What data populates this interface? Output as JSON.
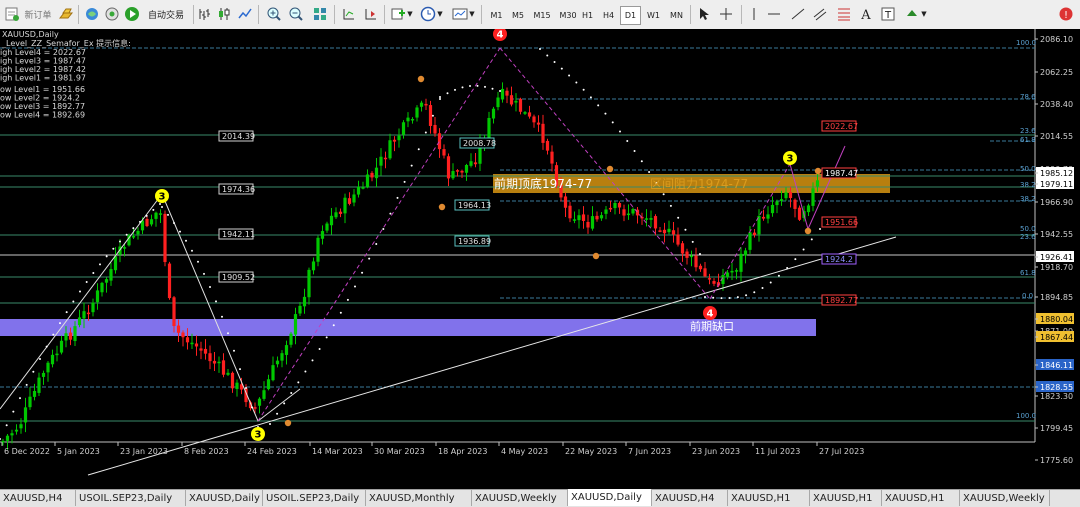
{
  "toolbar": {
    "new_order_label": "新订单",
    "auto_trade_label": "自动交易",
    "timeframes": [
      "M1",
      "M5",
      "M15",
      "M30",
      "H1",
      "H4",
      "D1",
      "W1",
      "MN"
    ],
    "active_timeframe": "D1"
  },
  "chart": {
    "symbol_line": "XAUUSD,Daily",
    "indicator_line": "_Level_ZZ_Semafor_Ex 提示信息:",
    "high_levels": [
      "igh Level4 = 2022.67",
      "igh Level3 = 1987.47",
      "igh Level2 = 1987.42",
      "igh Level1 = 1981.97"
    ],
    "low_levels": [
      "ow Level1 = 1951.66",
      "ow Level2 = 1924.2",
      "ow Level3 = 1892.77",
      "ow Level4 = 1892.69"
    ],
    "price_axis": [
      {
        "text": "2086.10",
        "type": "normal"
      },
      {
        "text": "2062.25",
        "type": "normal"
      },
      {
        "text": "2038.40",
        "type": "normal"
      },
      {
        "text": "2014.55",
        "type": "normal"
      },
      {
        "text": "1990.70",
        "type": "normal"
      },
      {
        "text": "1985.12",
        "type": "highlight-white"
      },
      {
        "text": "1979.11",
        "type": "highlight-white"
      },
      {
        "text": "1966.90",
        "type": "normal"
      },
      {
        "text": "1942.55",
        "type": "normal"
      },
      {
        "text": "1926.41",
        "type": "highlight-white"
      },
      {
        "text": "1918.70",
        "type": "normal"
      },
      {
        "text": "1894.85",
        "type": "normal"
      },
      {
        "text": "1880.04",
        "type": "highlight-yellow"
      },
      {
        "text": "1871.00",
        "type": "normal"
      },
      {
        "text": "1867.44",
        "type": "highlight-yellow"
      },
      {
        "text": "1846.11",
        "type": "highlight-blue"
      },
      {
        "text": "1828.55",
        "type": "highlight-blue"
      },
      {
        "text": "1823.30",
        "type": "normal"
      },
      {
        "text": "1799.45",
        "type": "normal"
      },
      {
        "text": "1775.60",
        "type": "normal"
      }
    ],
    "date_axis": [
      "6 Dec 2022",
      "5 Jan 2023",
      "23 Jan 2023",
      "8 Feb 2023",
      "24 Feb 2023",
      "14 Mar 2023",
      "30 Mar 2023",
      "18 Apr 2023",
      "4 May 2023",
      "22 May 2023",
      "7 Jun 2023",
      "23 Jun 2023",
      "11 Jul 2023",
      "27 Jul 2023"
    ],
    "fib_pct": [
      "100.0",
      "78.6",
      "23.6",
      "61.8",
      "50.0",
      "38.2",
      "38.2",
      "50.0",
      "23.6",
      "61.8",
      "0.0",
      "100.0"
    ],
    "level_boxes": [
      "2014.39",
      "1974.36",
      "1942.11",
      "1909.52",
      "2008.78",
      "1964.13",
      "1936.89"
    ],
    "right_boxes": [
      "2022.67",
      "1987.47",
      "1951.66",
      "1924.2",
      "1892.77",
      "1892.69"
    ],
    "annotation_top": "前期顶底1974-77",
    "annotation_top2": "区间阻力1974-77",
    "annotation_gap": "前期缺口",
    "semafor_labels": [
      "3",
      "4",
      "3",
      "3",
      "4"
    ],
    "colors": {
      "background": "#000000",
      "bull": "#00c800",
      "bear": "#ff2020",
      "gold_band": "#c88a10",
      "purple_band": "#8c7cff"
    }
  },
  "tabs": [
    "XAUUSD,H4",
    "USOIL.SEP23,Daily",
    "XAUUSD,Daily",
    "USOIL.SEP23,Daily",
    "XAUUSD,Monthly",
    "XAUUSD,Weekly",
    "XAUUSD,Daily",
    "XAUUSD,H4",
    "XAUUSD,H1",
    "XAUUSD,H1",
    "XAUUSD,H1",
    "XAUUSD,Weekly"
  ],
  "active_tab_index": 6
}
